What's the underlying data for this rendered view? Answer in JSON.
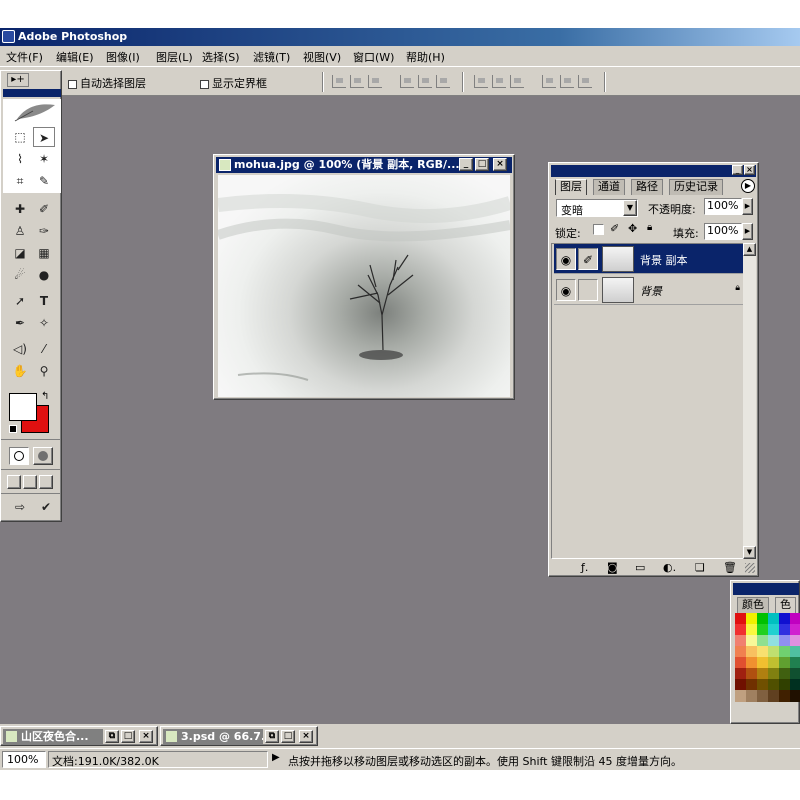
{
  "app": {
    "title": "Adobe Photoshop"
  },
  "menu": [
    "文件(F)",
    "编辑(E)",
    "图像(I)",
    "图层(L)",
    "选择(S)",
    "滤镜(T)",
    "视图(V)",
    "窗口(W)",
    "帮助(H)"
  ],
  "options": {
    "auto_select_label": "自动选择图层",
    "show_bounds_label": "显示定界框"
  },
  "document": {
    "title": "mohua.jpg @ 100% (背景 副本, RGB/..."
  },
  "layers_panel": {
    "tabs": [
      "图层",
      "通道",
      "路径",
      "历史记录"
    ],
    "blend_mode": "变暗",
    "opacity_label": "不透明度:",
    "opacity": "100%",
    "lock_label": "锁定:",
    "fill_label": "填充:",
    "fill": "100%",
    "layers": [
      {
        "name": "背景 副本",
        "selected": true
      },
      {
        "name": "背景",
        "selected": false,
        "locked": true
      }
    ]
  },
  "colors_panel": {
    "tabs": [
      "颜色",
      "色"
    ],
    "swatches": [
      [
        "#e01010",
        "#f0f000",
        "#00c000",
        "#00c0c0",
        "#1010d0",
        "#c000c0",
        "#e0e0e0"
      ],
      [
        "#f03030",
        "#f8f840",
        "#20d020",
        "#20d0d0",
        "#3030e0",
        "#d020d0",
        "#c8c8c8"
      ],
      [
        "#f08070",
        "#f8f898",
        "#90e090",
        "#90e0e0",
        "#9090f0",
        "#e090e0",
        "#b0b0b0"
      ],
      [
        "#f08050",
        "#f8c060",
        "#f8e070",
        "#c0e070",
        "#70d070",
        "#50c0a0",
        "#989898"
      ],
      [
        "#e05030",
        "#f09030",
        "#f0c030",
        "#c0c030",
        "#60a030",
        "#208050",
        "#808080"
      ],
      [
        "#a02010",
        "#b05010",
        "#b08010",
        "#808010",
        "#406010",
        "#105030",
        "#606060"
      ],
      [
        "#701000",
        "#703000",
        "#705000",
        "#505000",
        "#304000",
        "#003020",
        "#404040"
      ],
      [
        "#c0a080",
        "#a08060",
        "#806040",
        "#604020",
        "#402000",
        "#201000",
        "#000000"
      ]
    ]
  },
  "minimized_windows": [
    {
      "title": "山区夜色合..."
    },
    {
      "title": "3.psd @ 66.7..."
    }
  ],
  "status": {
    "zoom": "100%",
    "doc_info": "文档:191.0K/382.0K",
    "hint": "点按并拖移以移动图层或移动选区的副本。使用 Shift 键限制沿 45 度增量方向。"
  },
  "icons": {
    "app": "photoshop-feather-icon"
  },
  "colors": {
    "title_active": "#0a246a",
    "workspace": "#7f7b80",
    "foreground": "#ffffff",
    "background": "#e01010"
  }
}
